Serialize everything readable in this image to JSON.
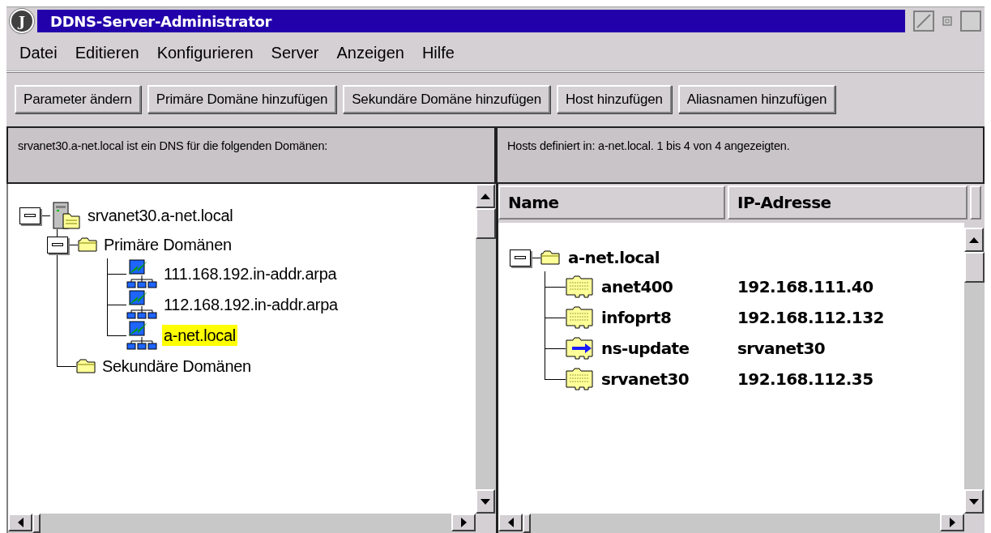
{
  "window": {
    "logo": "J",
    "title": "DDNS-Server-Administrator"
  },
  "menu": [
    "Datei",
    "Editieren",
    "Konfigurieren",
    "Server",
    "Anzeigen",
    "Hilfe"
  ],
  "toolbar": [
    "Parameter ändern",
    "Primäre Domäne hinzufügen",
    "Sekundäre Domäne hinzufügen",
    "Host hinzufügen",
    "Aliasnamen hinzufügen"
  ],
  "left_pane": {
    "caption": "srvanet30.a-net.local ist ein DNS für die folgenden Domänen:",
    "tree": [
      {
        "label": "srvanet30.a-net.local",
        "kind": "server",
        "expanded": true,
        "selected": false,
        "children": [
          {
            "label": "Primäre Domänen",
            "kind": "folder",
            "expanded": true,
            "selected": false,
            "children": [
              {
                "label": "111.168.192.in-addr.arpa",
                "kind": "zone",
                "selected": false
              },
              {
                "label": "112.168.192.in-addr.arpa",
                "kind": "zone",
                "selected": false
              },
              {
                "label": "a-net.local",
                "kind": "zone",
                "selected": true
              }
            ]
          },
          {
            "label": "Sekundäre Domänen",
            "kind": "folder",
            "selected": false
          }
        ]
      }
    ]
  },
  "right_pane": {
    "caption": "Hosts definiert in: a-net.local. 1 bis 4 von 4 angezeigten.",
    "columns": [
      "Name",
      "IP-Adresse"
    ],
    "tree": {
      "label": "a-net.local",
      "kind": "folder",
      "expanded": true,
      "selected": false,
      "children": [
        {
          "name": "anet400",
          "address": "192.168.111.40",
          "kind": "host",
          "selected": false
        },
        {
          "name": "infoprt8",
          "address": "192.168.112.132",
          "kind": "host",
          "selected": false
        },
        {
          "name": "ns-update",
          "address": "srvanet30",
          "kind": "alias",
          "selected": false
        },
        {
          "name": "srvanet30",
          "address": "192.168.112.35",
          "kind": "host",
          "selected": false
        }
      ]
    }
  }
}
